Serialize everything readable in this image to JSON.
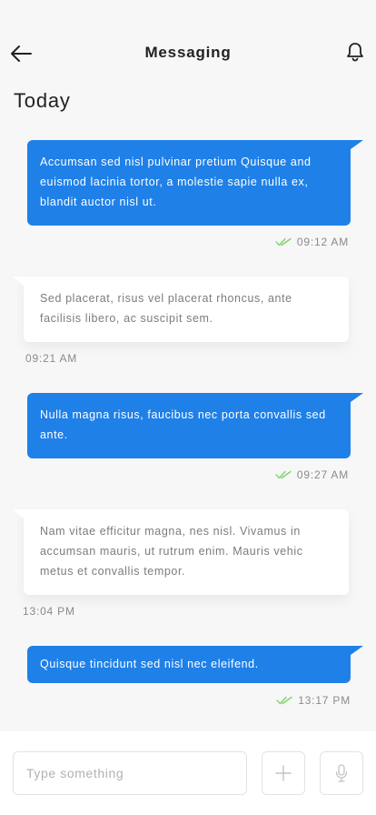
{
  "header": {
    "title": "Messaging"
  },
  "date_heading": "Today",
  "messages": [
    {
      "direction": "sent",
      "text": "Accumsan sed nisl pulvinar pretium Quisque and euismod lacinia tortor, a molestie sapie nulla ex, blandit auctor nisl ut.",
      "time": "09:12 AM",
      "read": true
    },
    {
      "direction": "received",
      "text": "Sed placerat, risus vel placerat rhoncus, ante facilisis libero, ac suscipit sem.",
      "time": "09:21 AM"
    },
    {
      "direction": "sent",
      "text": " Nulla magna risus, faucibus nec porta convallis sed ante.",
      "time": "09:27 AM",
      "read": true
    },
    {
      "direction": "received",
      "text": "Nam vitae efficitur magna, nes nisl. Vivamus in accumsan mauris, ut rutrum enim. Mauris vehic metus et convallis tempor.",
      "time": "13:04 PM"
    },
    {
      "direction": "sent",
      "text": "Quisque tincidunt sed nisl nec eleifend.",
      "time": "13:17 PM",
      "read": true
    }
  ],
  "composer": {
    "placeholder": "Type something",
    "value": ""
  },
  "colors": {
    "sent_bubble": "#1f80e8",
    "received_bubble": "#ffffff",
    "read_check": "#7ed36b",
    "background": "#f7f7f7"
  },
  "icons": {
    "back": "arrow-left-icon",
    "notifications": "bell-icon",
    "read_receipt": "double-check-icon",
    "add": "plus-icon",
    "voice": "microphone-icon"
  }
}
